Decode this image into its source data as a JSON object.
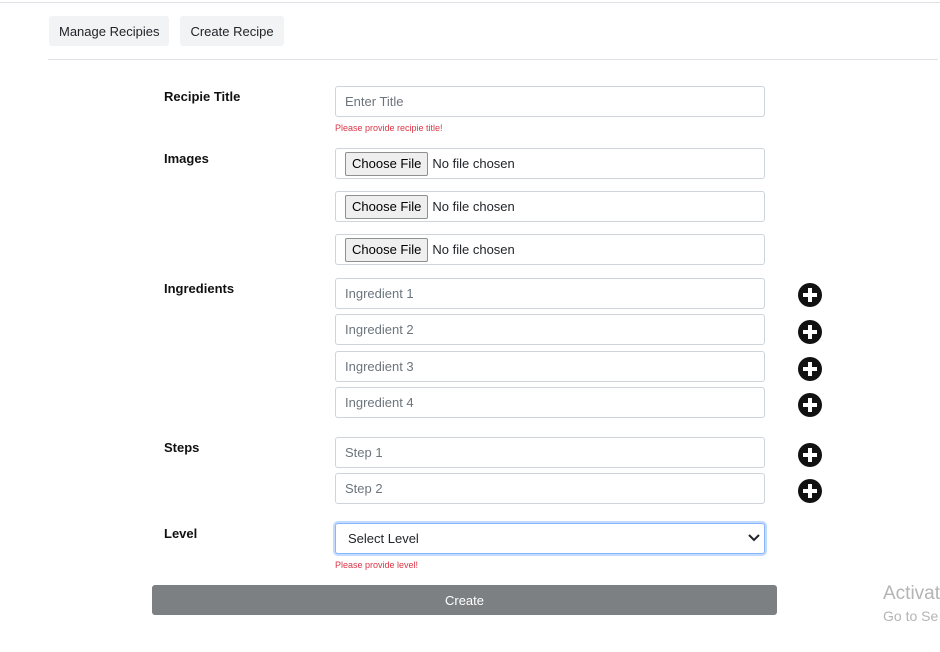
{
  "tabs": [
    {
      "label": "Manage Recipies"
    },
    {
      "label": "Create Recipe"
    }
  ],
  "form": {
    "title": {
      "label": "Recipie Title",
      "placeholder": "Enter Title",
      "value": "",
      "error": "Please provide recipie title!"
    },
    "images": {
      "label": "Images",
      "inputs": [
        {
          "button": "Choose File",
          "status": "No file chosen"
        },
        {
          "button": "Choose File",
          "status": "No file chosen"
        },
        {
          "button": "Choose File",
          "status": "No file chosen"
        }
      ]
    },
    "ingredients": {
      "label": "Ingredients",
      "items": [
        {
          "placeholder": "Ingredient 1",
          "value": ""
        },
        {
          "placeholder": "Ingredient 2",
          "value": ""
        },
        {
          "placeholder": "Ingredient 3",
          "value": ""
        },
        {
          "placeholder": "Ingredient 4",
          "value": ""
        }
      ]
    },
    "steps": {
      "label": "Steps",
      "items": [
        {
          "placeholder": "Step 1",
          "value": ""
        },
        {
          "placeholder": "Step 2",
          "value": ""
        }
      ]
    },
    "level": {
      "label": "Level",
      "selected": "Select Level",
      "error": "Please provide level!"
    },
    "submit_label": "Create"
  },
  "add_icon": "plus-circle-icon",
  "watermark": {
    "line1": "Activat",
    "line2": "Go to Se"
  },
  "colors": {
    "error": "#dc3545",
    "submit_bg": "#7d8083",
    "focus_border": "#86b7fe",
    "tab_bg": "#f1f3f5"
  }
}
